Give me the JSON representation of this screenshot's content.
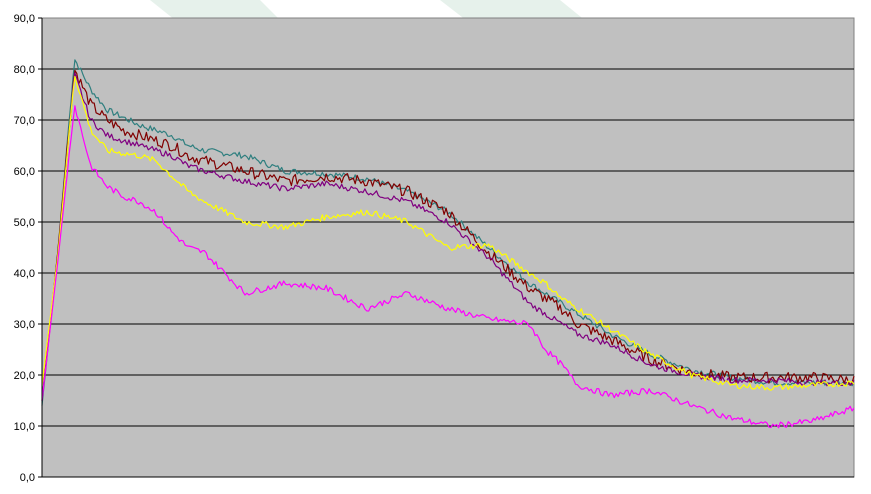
{
  "chart_data": {
    "type": "line",
    "title": "",
    "xlabel": "",
    "ylabel": "",
    "ylim": [
      0,
      90
    ],
    "yticks": [
      0,
      10,
      20,
      30,
      40,
      50,
      60,
      70,
      80,
      90
    ],
    "ytick_labels": [
      "0,0",
      "10,0",
      "20,0",
      "30,0",
      "40,0",
      "50,0",
      "60,0",
      "70,0",
      "80,0",
      "90,0"
    ],
    "grid": "horizontal",
    "legend": "none",
    "plot_background": "#c0c0c0",
    "x": [
      0,
      2,
      4,
      6,
      8,
      10,
      12,
      14,
      16,
      18,
      20,
      25,
      30,
      35,
      40,
      45,
      50,
      55,
      60,
      62,
      64,
      66,
      70,
      75,
      80,
      85,
      90,
      95,
      100
    ],
    "series": [
      {
        "color": "#2f7f7f",
        "values": [
          14,
          45,
          82,
          76,
          72,
          70.5,
          69,
          68,
          67,
          65,
          64,
          63,
          60,
          59.5,
          58.5,
          56,
          52,
          45,
          38,
          36,
          34,
          32,
          28,
          24,
          21,
          19.5,
          18.5,
          18.5,
          18.5
        ]
      },
      {
        "color": "#800000",
        "values": [
          15,
          45,
          80,
          73,
          70,
          68,
          67,
          66,
          65,
          63,
          62,
          60,
          58,
          59,
          58,
          56,
          52,
          44,
          37,
          35,
          33,
          30,
          27,
          23,
          20.5,
          19.5,
          19.5,
          19.5,
          19
        ]
      },
      {
        "color": "#800080",
        "values": [
          15,
          44,
          79,
          70,
          67,
          66,
          65,
          64,
          63,
          61,
          60,
          58,
          56.5,
          57.5,
          56,
          54,
          50,
          43,
          34,
          32,
          30,
          28,
          26,
          22,
          20,
          19,
          19,
          18.5,
          18.5
        ]
      },
      {
        "color": "#ffff00",
        "values": [
          18,
          44,
          79,
          68,
          64,
          63.5,
          63,
          62,
          59,
          56,
          54,
          50,
          49,
          51,
          52,
          50,
          45,
          45.5,
          40,
          38,
          35,
          33,
          29,
          24,
          20,
          18,
          17.5,
          18,
          18.5
        ]
      },
      {
        "color": "#ff00ff",
        "values": [
          15,
          43,
          73,
          61,
          57,
          55,
          54,
          52,
          48,
          45,
          44,
          36,
          38,
          37,
          33,
          36,
          33,
          31,
          30,
          25,
          22,
          18,
          16,
          17,
          14,
          11.5,
          10,
          11,
          13.5
        ]
      }
    ]
  }
}
